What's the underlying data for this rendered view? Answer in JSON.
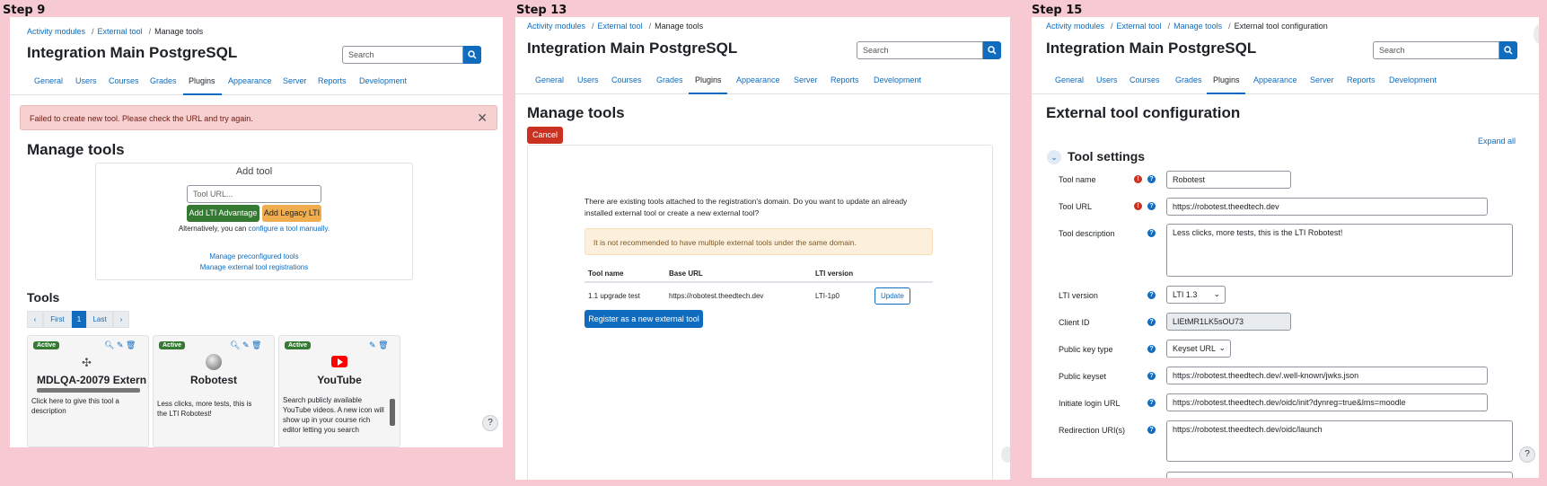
{
  "steps": [
    "Step 9",
    "Step 13",
    "Step 15"
  ],
  "common": {
    "site_title": "Integration Main PostgreSQL",
    "search_placeholder": "Search",
    "nav": [
      "General",
      "Users",
      "Courses",
      "Grades",
      "Plugins",
      "Appearance",
      "Server",
      "Reports",
      "Development"
    ]
  },
  "p1": {
    "breadcrumb": [
      "Activity modules",
      "External tool",
      "Manage tools"
    ],
    "alert": "Failed to create new tool. Please check the URL and try again.",
    "heading": "Manage tools",
    "addtool": {
      "title": "Add tool",
      "url_placeholder": "Tool URL...",
      "lti_adv": "Add LTI Advantage",
      "legacy": "Add Legacy LTI",
      "alt_prefix": "Alternatively, you can",
      "alt_link": "configure a tool manually.",
      "preconfig": "Manage preconfigured tools",
      "registrations": "Manage external tool registrations"
    },
    "tools_heading": "Tools",
    "pager": {
      "first": "First",
      "page": "1",
      "last": "Last"
    },
    "cards": [
      {
        "badge": "Active",
        "title": "MDLQA-20079 Extern",
        "desc": "Click here to give this tool a description"
      },
      {
        "badge": "Active",
        "title": "Robotest",
        "desc": "Less clicks, more tests, this is the LTI Robotest!"
      },
      {
        "badge": "Active",
        "title": "YouTube",
        "desc": "Search publicly available YouTube videos. A new icon will show up in your course rich editor letting you search"
      }
    ]
  },
  "p2": {
    "breadcrumb": [
      "Activity modules",
      "External tool",
      "Manage tools"
    ],
    "heading": "Manage tools",
    "cancel": "Cancel",
    "message": "There are existing tools attached to the registration's domain. Do you want to update an already installed external tool or create a new external tool?",
    "warning": "It is not recommended to have multiple external tools under the same domain.",
    "table": {
      "headers": [
        "Tool name",
        "Base URL",
        "LTI version"
      ],
      "rows": [
        [
          "1.1 upgrade test",
          "https://robotest.theedtech.dev",
          "LTI-1p0"
        ]
      ],
      "update": "Update"
    },
    "register": "Register as a new external tool"
  },
  "p3": {
    "breadcrumb": [
      "Activity modules",
      "External tool",
      "Manage tools",
      "External tool configuration"
    ],
    "heading": "External tool configuration",
    "expand_all": "Expand all",
    "section": "Tool settings",
    "fields": {
      "tool_name": {
        "label": "Tool name",
        "value": "Robotest"
      },
      "tool_url": {
        "label": "Tool URL",
        "value": "https://robotest.theedtech.dev"
      },
      "tool_desc": {
        "label": "Tool description",
        "value": "Less clicks, more tests, this is the LTI Robotest!"
      },
      "lti_version": {
        "label": "LTI version",
        "value": "LTI 1.3"
      },
      "client_id": {
        "label": "Client ID",
        "value": "LIEtMR1LK5sOU73"
      },
      "pubkey_type": {
        "label": "Public key type",
        "value": "Keyset URL"
      },
      "pubkeyset": {
        "label": "Public keyset",
        "value": "https://robotest.theedtech.dev/.well-known/jwks.json"
      },
      "login_url": {
        "label": "Initiate login URL",
        "value": "https://robotest.theedtech.dev/oidc/init?dynreg=true&lms=moodle"
      },
      "redirect": {
        "label": "Redirection URI(s)",
        "value": "https://robotest.theedtech.dev/oidc/launch"
      }
    }
  },
  "help_glyph": "?"
}
